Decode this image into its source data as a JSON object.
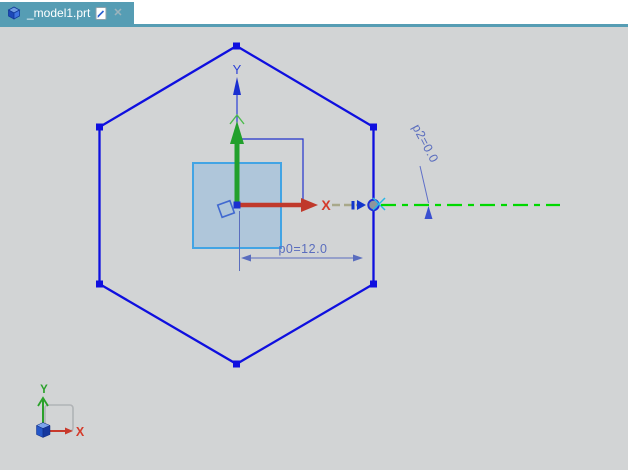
{
  "tab_bar": {
    "tab": {
      "title": "_model1.prt",
      "icon": "part-cube-icon",
      "modified_icon": "document-edit-icon",
      "close_glyph": "✕"
    },
    "accent_color": "#569db4"
  },
  "canvas": {
    "background_color": "#d2d4d5",
    "labels": {
      "dim_p0": "p0=12.0",
      "dim_p2": "p2=0.0",
      "sketch_axis_y": "Y",
      "axis_x_marker": "X"
    },
    "values": {
      "p0": 12.0,
      "p2": 0.0
    },
    "geometry": {
      "hexagon_sides": 6,
      "hexagon_color": "#0f0fdf",
      "square_fill": "#a9c3da",
      "square_stroke": "#42a4e4",
      "wcs_x_color": "#c0392b",
      "wcs_y_color": "#22a02c",
      "centerline_color": "#00d800",
      "construction_color": "#a8a88a",
      "dimension_color": "#5a6dbe"
    },
    "view_triad": {
      "x_label": "X",
      "y_label": "Y"
    }
  }
}
